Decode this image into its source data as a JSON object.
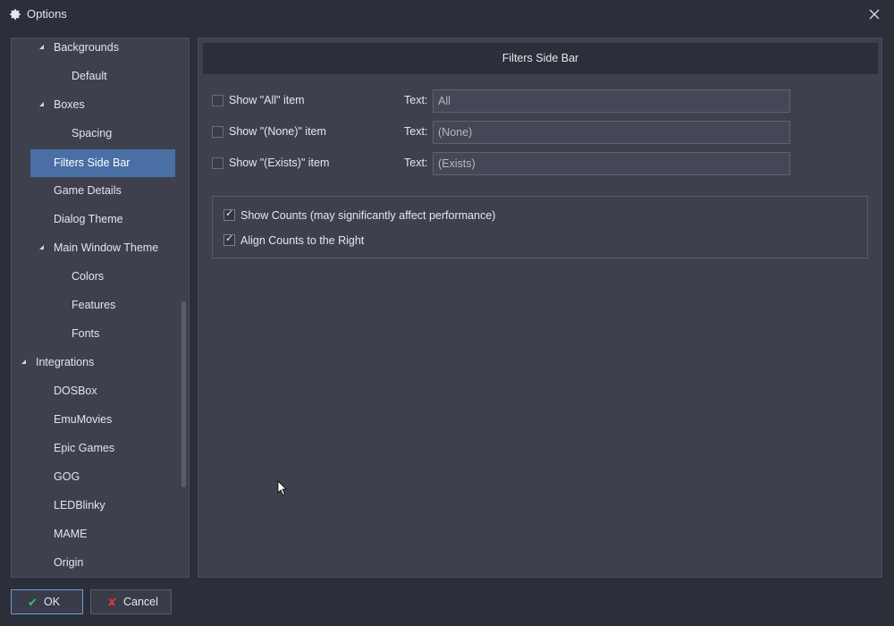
{
  "window": {
    "title": "Options",
    "close_label": "✕"
  },
  "tree": {
    "items": [
      {
        "label": "Backgrounds",
        "level": 1,
        "expanded": true
      },
      {
        "label": "Default",
        "level": 2
      },
      {
        "label": "Boxes",
        "level": 1,
        "expanded": true
      },
      {
        "label": "Spacing",
        "level": 2
      },
      {
        "label": "Filters Side Bar",
        "level": 1,
        "selected": true
      },
      {
        "label": "Game Details",
        "level": 1
      },
      {
        "label": "Dialog Theme",
        "level": 1
      },
      {
        "label": "Main Window Theme",
        "level": 1,
        "expanded": true
      },
      {
        "label": "Colors",
        "level": 2
      },
      {
        "label": "Features",
        "level": 2
      },
      {
        "label": "Fonts",
        "level": 2
      },
      {
        "label": "Integrations",
        "level": 0,
        "expanded": true
      },
      {
        "label": "DOSBox",
        "level": 1
      },
      {
        "label": "EmuMovies",
        "level": 1
      },
      {
        "label": "Epic Games",
        "level": 1
      },
      {
        "label": "GOG",
        "level": 1
      },
      {
        "label": "LEDBlinky",
        "level": 1
      },
      {
        "label": "MAME",
        "level": 1
      },
      {
        "label": "Origin",
        "level": 1
      }
    ]
  },
  "content": {
    "header": "Filters Side Bar",
    "rows": [
      {
        "label": "Show \"All\" item",
        "checked": false,
        "text_label": "Text:",
        "value": "All"
      },
      {
        "label": "Show \"(None)\" item",
        "checked": false,
        "text_label": "Text:",
        "value": "(None)"
      },
      {
        "label": "Show \"(Exists)\" item",
        "checked": false,
        "text_label": "Text:",
        "value": "(Exists)"
      }
    ],
    "counts": [
      {
        "label": "Show Counts (may significantly affect performance)",
        "checked": true
      },
      {
        "label": "Align Counts to the Right",
        "checked": true
      }
    ]
  },
  "footer": {
    "ok_label": "OK",
    "cancel_label": "Cancel"
  },
  "colors": {
    "accent": "#4a6fa5",
    "ok_icon": "#3fbf5a",
    "cancel_icon": "#d83a3a"
  },
  "icons": {
    "title": "gear-icon",
    "close": "close-icon",
    "ok": "checkmark-icon",
    "cancel": "x-icon"
  }
}
